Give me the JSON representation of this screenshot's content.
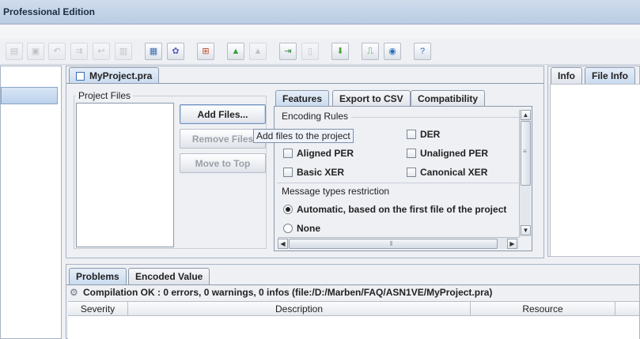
{
  "window": {
    "title": "Professional Edition"
  },
  "toolbar": {
    "buttons": [
      {
        "icon": "new-file-icon",
        "glyph": "▤",
        "color": "#8a8a8a",
        "enabled": false
      },
      {
        "icon": "save-icon",
        "glyph": "▣",
        "color": "#8a8a8a",
        "enabled": false
      },
      {
        "icon": "undo-icon",
        "glyph": "↶",
        "color": "#8a8a8a",
        "enabled": false
      },
      {
        "icon": "compile-all-icon",
        "glyph": "⇉",
        "color": "#8a8a8a",
        "enabled": false
      },
      {
        "icon": "revert-icon",
        "glyph": "↩",
        "color": "#8a8a8a",
        "enabled": false
      },
      {
        "icon": "stack-icon",
        "glyph": "▥",
        "color": "#8a8a8a",
        "enabled": false
      },
      {
        "icon": "window-icon",
        "glyph": "▦",
        "color": "#3c6fb0",
        "enabled": true
      },
      {
        "icon": "settings-icon",
        "glyph": "✿",
        "color": "#5a5fc0",
        "enabled": true
      },
      {
        "icon": "tree-icon",
        "glyph": "⊞",
        "color": "#c04a2a",
        "enabled": true
      },
      {
        "icon": "shapes-icon",
        "glyph": "▲",
        "color": "#3aa040",
        "enabled": true
      },
      {
        "icon": "shapes-disabled-icon",
        "glyph": "▲",
        "color": "#8a8a8a",
        "enabled": false
      },
      {
        "icon": "import-icon",
        "glyph": "⇥",
        "color": "#2e8a3a",
        "enabled": true
      },
      {
        "icon": "document-icon",
        "glyph": "▯",
        "color": "#8a8a8a",
        "enabled": false
      },
      {
        "icon": "deploy-icon",
        "glyph": "⬇",
        "color": "#4aa040",
        "enabled": true
      },
      {
        "icon": "monitor-icon",
        "glyph": "⎍",
        "color": "#1f8a3a",
        "enabled": true
      },
      {
        "icon": "search-icon",
        "glyph": "◉",
        "color": "#2a70b8",
        "enabled": true
      },
      {
        "icon": "help-icon",
        "glyph": "?",
        "color": "#2a70c8",
        "enabled": true
      }
    ]
  },
  "project": {
    "tab_label": "MyProject.pra",
    "files_group_title": "Project Files",
    "buttons": {
      "add": "Add Files...",
      "remove": "Remove Files",
      "move_top": "Move to Top"
    },
    "tooltip": "Add files to the project"
  },
  "features": {
    "tabs": [
      "Features",
      "Export to CSV",
      "Compatibility"
    ],
    "encoding_rules_title": "Encoding Rules",
    "checkboxes": [
      {
        "label": "DER",
        "checked": false
      },
      {
        "label": "Aligned PER",
        "checked": false
      },
      {
        "label": "Unaligned PER",
        "checked": false
      },
      {
        "label": "Basic XER",
        "checked": false
      },
      {
        "label": "Canonical XER",
        "checked": false
      }
    ],
    "message_types_title": "Message types restriction",
    "radios": [
      {
        "label": "Automatic, based on the first file of the project",
        "selected": true
      },
      {
        "label": "None",
        "selected": false
      }
    ]
  },
  "right_panel": {
    "tabs": [
      "Info",
      "File Info"
    ]
  },
  "bottom": {
    "tabs": [
      "Problems",
      "Encoded Value"
    ],
    "status": "Compilation OK : 0 errors, 0 warnings, 0 infos (file:/D:/Marben/FAQ/ASN1VE/MyProject.pra)",
    "columns": [
      "Severity",
      "Description",
      "Resource"
    ]
  }
}
